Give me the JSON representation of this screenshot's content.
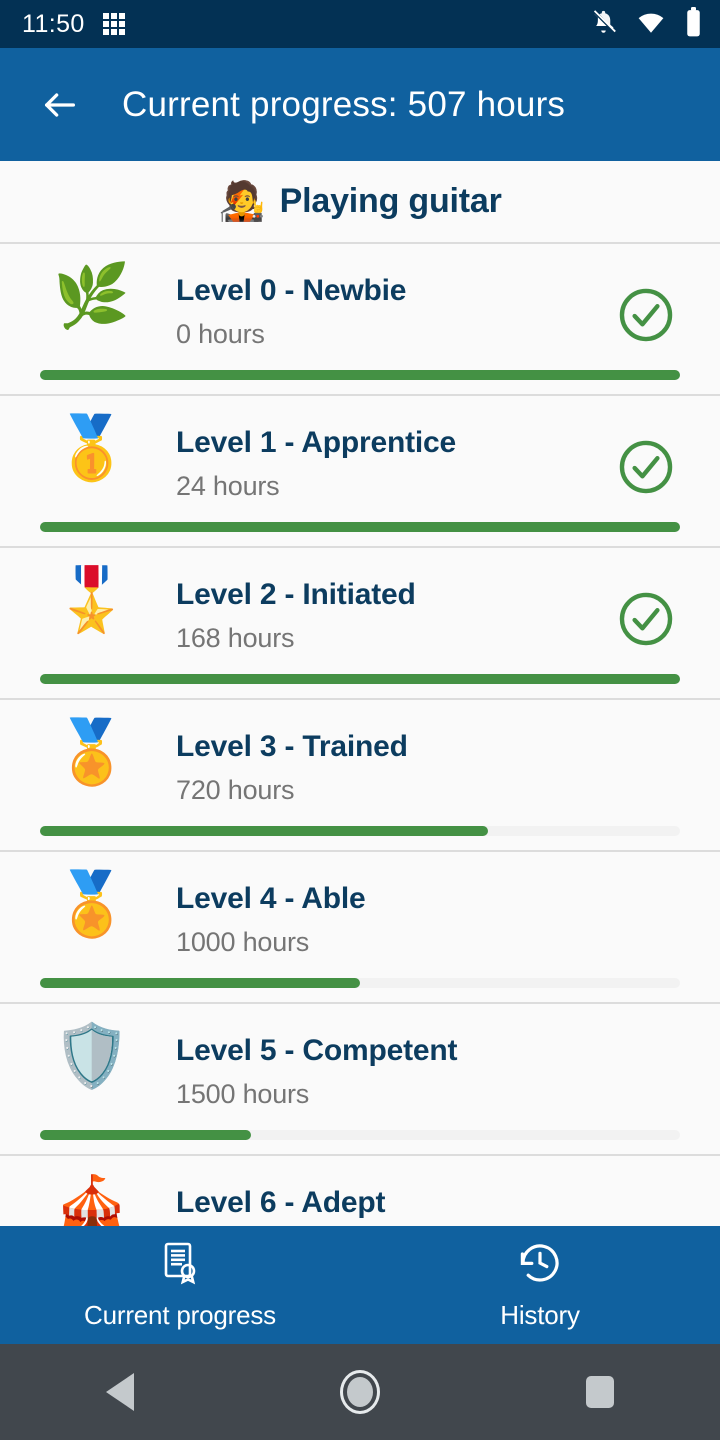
{
  "status_bar": {
    "time": "11:50",
    "icons": [
      "apps-grid-icon",
      "notifications-off-icon",
      "wifi-icon",
      "battery-full-icon"
    ]
  },
  "app_bar": {
    "back_label": "Back",
    "title": "Current progress: 507 hours"
  },
  "activity": {
    "emoji": "🧑‍🎤",
    "emoji_name": "guitarist-emoji",
    "name": "Playing guitar"
  },
  "levels": [
    {
      "emoji": "🌿",
      "emoji_name": "laurel-leaves-emoji",
      "title": "Level 0 - Newbie",
      "hours": "0 hours",
      "progress": 100,
      "completed": true
    },
    {
      "emoji": "🥇",
      "emoji_name": "first-place-medal-emoji",
      "title": "Level 1 - Apprentice",
      "hours": "24 hours",
      "progress": 100,
      "completed": true
    },
    {
      "emoji": "🎖️",
      "emoji_name": "military-medal-emoji",
      "title": "Level 2 - Initiated",
      "hours": "168 hours",
      "progress": 100,
      "completed": true
    },
    {
      "emoji": "🏅",
      "emoji_name": "sports-medal-emoji",
      "title": "Level 3 - Trained",
      "hours": "720 hours",
      "progress": 70,
      "completed": false
    },
    {
      "emoji": "🏅",
      "emoji_name": "gold-medal-emoji",
      "title": "Level 4 - Able",
      "hours": "1000 hours",
      "progress": 50,
      "completed": false
    },
    {
      "emoji": "🛡️",
      "emoji_name": "shield-badge-emoji",
      "title": "Level 5 - Competent",
      "hours": "1500 hours",
      "progress": 33,
      "completed": false
    },
    {
      "emoji": "🎪",
      "emoji_name": "award-banner-emoji",
      "title": "Level 6 - Adept",
      "hours": "",
      "progress": 0,
      "completed": false
    }
  ],
  "bottom_nav": {
    "items": [
      {
        "label": "Current progress",
        "icon": "certificate-icon",
        "selected": true
      },
      {
        "label": "History",
        "icon": "history-clock-icon",
        "selected": false
      }
    ]
  },
  "system_nav": {
    "back": "Back",
    "home": "Home",
    "recents": "Recent apps"
  },
  "colors": {
    "status_bar": "#033154",
    "app_bar": "#10619f",
    "accent_green": "#449144",
    "title_navy": "#0c3c5f",
    "hours_gray": "#757575",
    "track_gray": "#f2f2f2",
    "divider": "#dcdcdc",
    "sysnav": "#41474d"
  }
}
